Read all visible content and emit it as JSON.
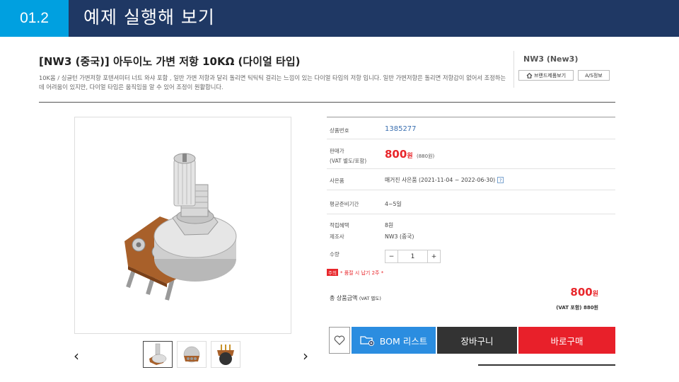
{
  "slide": {
    "number": "01.2",
    "title": "예제 실행해 보기"
  },
  "product": {
    "title": "[NW3 (중국)] 아두이노 가변 저항 10KΩ (다이얼 타입)",
    "description": "10K옴 / 싱글턴 가변저항 포텐셔미터 너트 와샤 포함 , 일반 가변 저항과 달리 돌리면 틱틱틱 걸리는 느낌이 있는 다이얼 타입의 저항 입니다. 일반 가변저항은 돌리면 저항감이 없어서 조정하는데 어려움이 있지만, 다이얼 타입은 움직임을 알 수 있어 조정이 원활합니다.",
    "brand": "NW3 (New3)",
    "brand_products_button": "브랜드제품보기",
    "as_info_button": "A/S정보"
  },
  "info": {
    "product_code_label": "상품번호",
    "product_code": "1385277",
    "price_label_1": "판매가",
    "price_label_2": "(VAT 별도/포함)",
    "price": "800",
    "price_unit": "원",
    "price_vat": "(880원)",
    "status_label": "사은품",
    "status_value": "매거진 사은품 (2021-11-04 ~ 2022-06-30)",
    "status_help": "?",
    "lead_time_label": "평균준비기간",
    "lead_time": "4~5일",
    "points_label": "적립혜택",
    "points": "8원",
    "maker_label": "제조사",
    "maker": "NW3 (중국)",
    "qty_label": "수량",
    "qty_minus": "−",
    "qty_value": "1",
    "qty_plus": "+",
    "notice_badge": "주의",
    "notice_text": "* 품절 시 납기 2주 *",
    "total_label": "총 상품금액",
    "total_label_sub": "(VAT 별도)",
    "total_price": "800",
    "total_unit": "원",
    "total_vat": "(VAT 포함) 880원"
  },
  "actions": {
    "bom_label": "BOM 리스트",
    "cart_label": "장바구니",
    "buy_label": "바로구매"
  },
  "gallery": {
    "prev": "‹",
    "next": "›"
  },
  "colors": {
    "header": "#1f3864",
    "accent": "#00a0e0",
    "price": "#e8262b",
    "bom": "#2b8de0",
    "buy": "#e8202a"
  }
}
